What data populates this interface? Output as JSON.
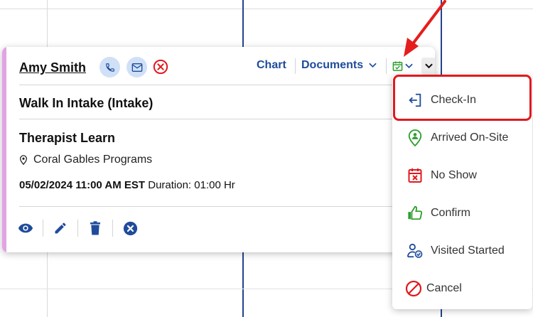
{
  "popup": {
    "client_name": "Amy Smith",
    "links": {
      "chart": "Chart",
      "documents": "Documents"
    },
    "appointment_type": "Walk In Intake (Intake)",
    "provider": "Therapist Learn",
    "location": "Coral Gables Programs",
    "datetime": "05/02/2024 11:00 AM EST",
    "duration": " Duration: 01:00 Hr"
  },
  "status_menu": {
    "items": [
      {
        "label": "Check-In",
        "icon": "check-in-icon",
        "color": "#1f4b9b"
      },
      {
        "label": "Arrived On-Site",
        "icon": "location-person-icon",
        "color": "#2e9e2e"
      },
      {
        "label": "No Show",
        "icon": "calendar-x-icon",
        "color": "#e0191f"
      },
      {
        "label": "Confirm",
        "icon": "thumbs-up-icon",
        "color": "#2e9e2e"
      },
      {
        "label": "Visited Started",
        "icon": "user-check-icon",
        "color": "#1f4b9b"
      },
      {
        "label": "Cancel",
        "icon": "cancel-circle-icon",
        "color": "#e0191f"
      }
    ]
  },
  "colors": {
    "brand_blue": "#1f4b9b",
    "stripe": "#e2a3e4",
    "highlight_red": "#e0191f"
  }
}
